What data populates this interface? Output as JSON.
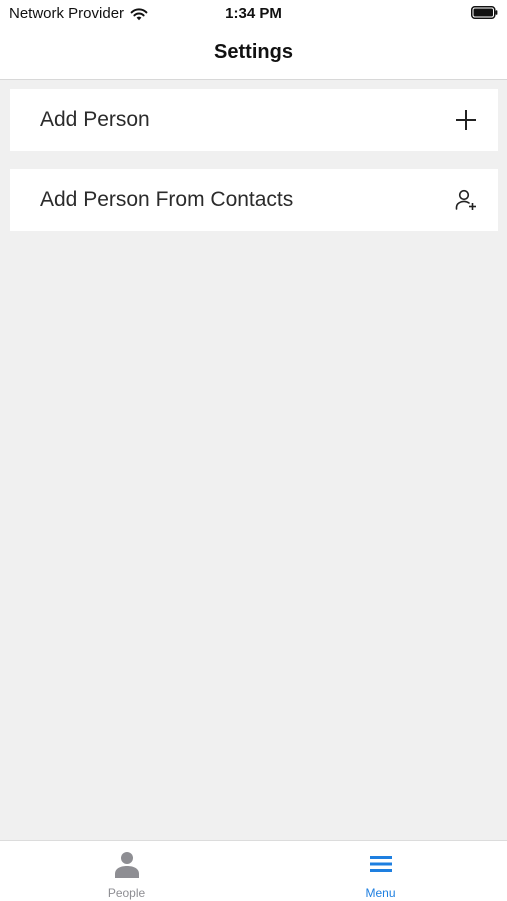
{
  "status_bar": {
    "carrier": "Network Provider",
    "time": "1:34 PM",
    "icons": [
      "wifi-icon",
      "battery-icon"
    ]
  },
  "nav": {
    "title": "Settings"
  },
  "rows": [
    {
      "label": "Add Person",
      "icon": "plus-icon"
    },
    {
      "label": "Add Person From Contacts",
      "icon": "person-add-icon"
    }
  ],
  "tabs": [
    {
      "label": "People",
      "icon": "person-icon",
      "selected": false
    },
    {
      "label": "Menu",
      "icon": "menu-icon",
      "selected": true
    }
  ],
  "colors": {
    "accent": "#1e7fe0",
    "inactive_tab": "#8e8e93",
    "background": "#f0f0f0",
    "surface": "#ffffff"
  }
}
